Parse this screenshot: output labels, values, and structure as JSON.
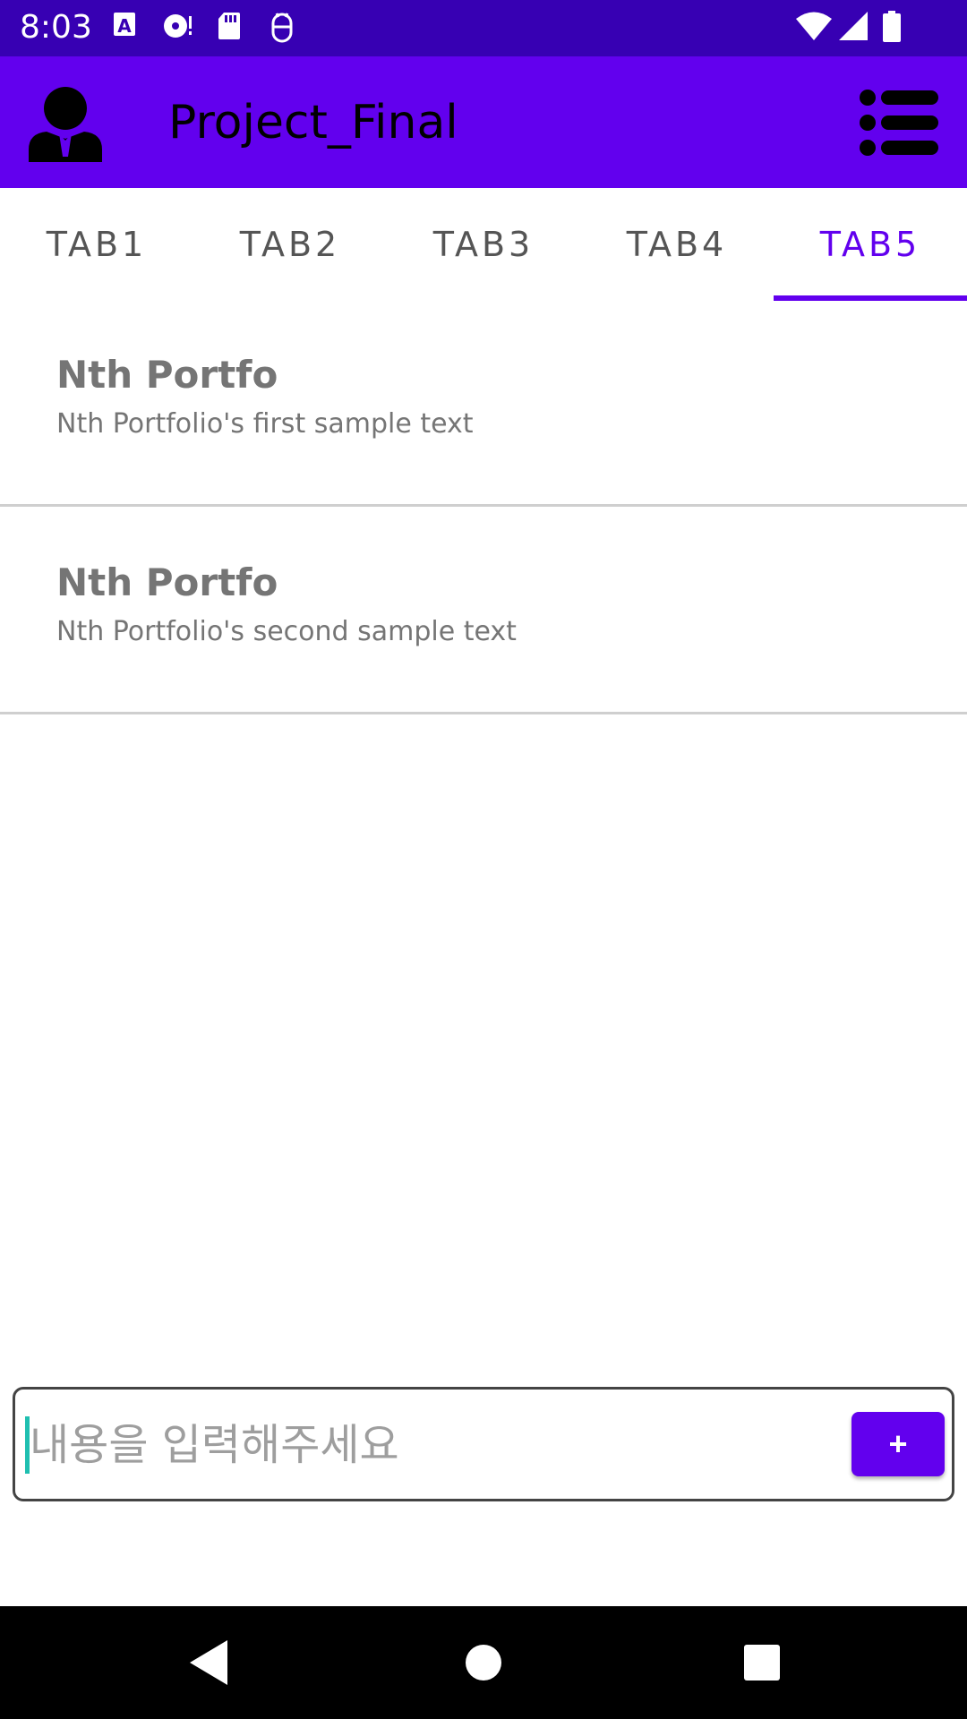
{
  "status_bar": {
    "time": "8:03",
    "left_icons": [
      "font-a-icon",
      "media-icon",
      "sd-card-icon",
      "android-debug-icon"
    ],
    "right_icons": [
      "wifi-icon",
      "cell-signal-icon",
      "battery-icon"
    ]
  },
  "app_bar": {
    "title": "Project_Final",
    "avatar_icon": "person-icon",
    "menu_icon": "list-menu-icon"
  },
  "tabs": [
    {
      "label": "TAB1",
      "active": false
    },
    {
      "label": "TAB2",
      "active": false
    },
    {
      "label": "TAB3",
      "active": false
    },
    {
      "label": "TAB4",
      "active": false
    },
    {
      "label": "TAB5",
      "active": true
    }
  ],
  "list": {
    "items": [
      {
        "title": "Nth Portfo",
        "text": "Nth Portfolio's first sample text"
      },
      {
        "title": "Nth Portfo",
        "text": "Nth Portfolio's second sample text"
      }
    ]
  },
  "input": {
    "value": "",
    "placeholder": "내용을 입력해주세요",
    "add_label": "+"
  },
  "nav": {
    "icons": [
      "back-icon",
      "home-icon",
      "recents-icon"
    ]
  },
  "colors": {
    "status_bar": "#3700b3",
    "primary": "#6200ee",
    "cursor": "#1fbfb0"
  }
}
